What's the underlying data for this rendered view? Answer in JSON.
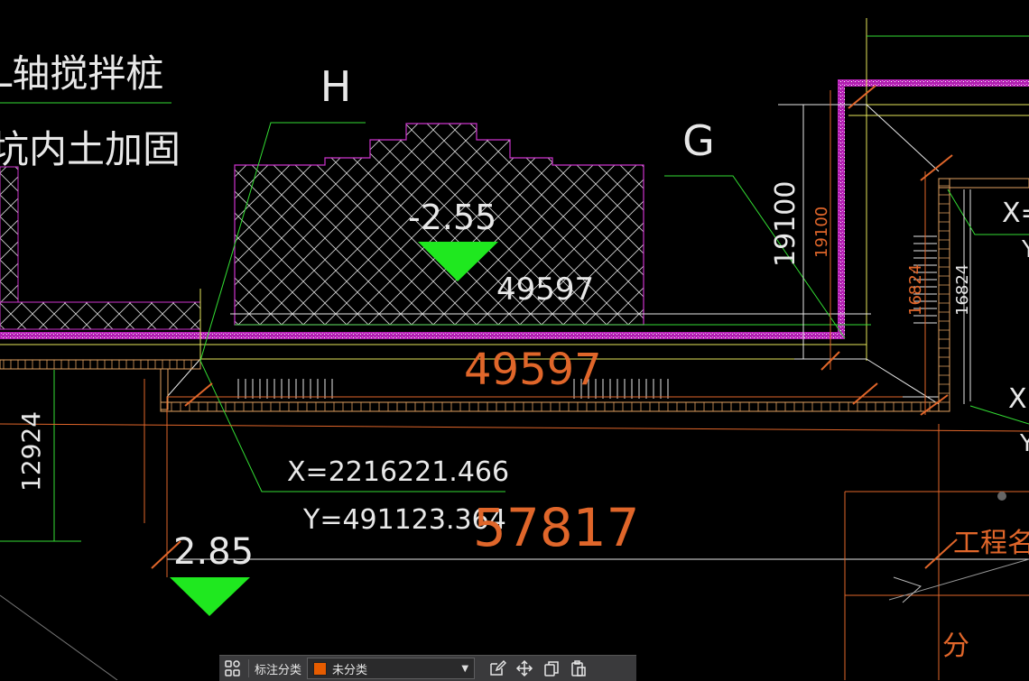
{
  "drawing": {
    "label_H": "H",
    "label_G": "G",
    "note_line1": "L轴搅拌桩",
    "note_line2": "坑内土加固",
    "elev_inner": "-2.55",
    "elev_outer": "2.85",
    "inner_dim": "49597",
    "main_dim": "49597",
    "coord_x": "X=2216221.466",
    "coord_y": "Y=491123.364",
    "dim_57817": "57817",
    "dim_19100_white": "19100",
    "dim_19100_orange": "19100",
    "dim_16824_orange": "16824",
    "dim_16824_white": "16824",
    "dim_12924": "12924",
    "x_label_top": "X=",
    "x_label_bottom": "X",
    "y_label_bottom": "Y",
    "y_label_top": "Y",
    "title_block_1": "工程名",
    "title_block_2": "分",
    "colors": {
      "background": "#000000",
      "magenta": "#cc33cc",
      "orange": "#e0662a",
      "green": "#1fe81f",
      "white": "#e8e8e8",
      "yellow": "#e6e65a",
      "lime": "#33dd33"
    }
  },
  "toolbar": {
    "label": "标注分类",
    "select_value": "未分类",
    "swatch_color": "#e65c00",
    "icons": [
      "layout-grid-icon",
      "edit-icon",
      "move-icon",
      "copy-icon",
      "paste-icon"
    ]
  }
}
